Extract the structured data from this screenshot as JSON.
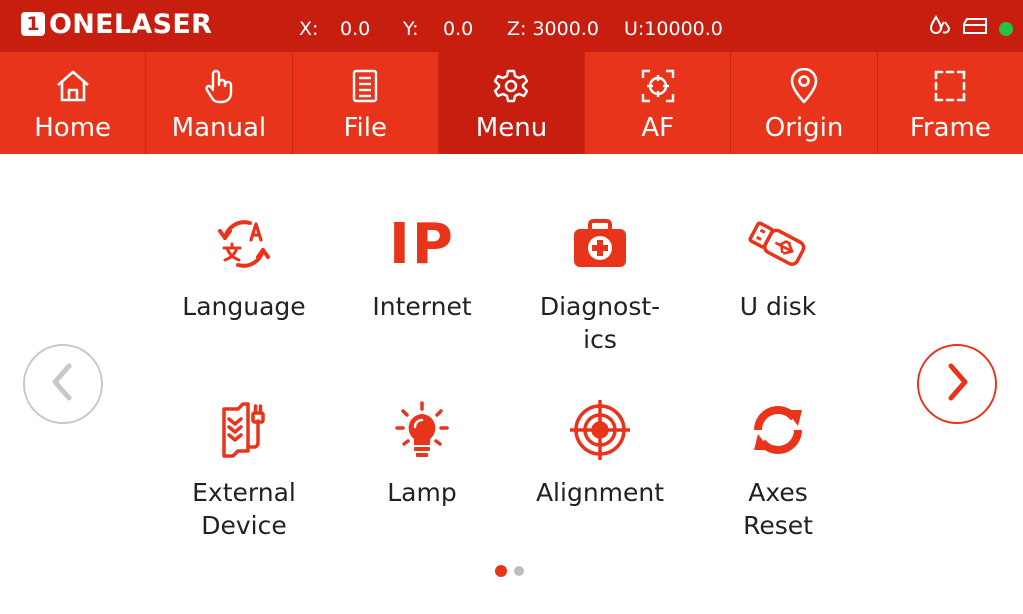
{
  "brand": {
    "badge": "1",
    "name": "ONELASER"
  },
  "coords": {
    "x_label": "X:",
    "x_value": "0.0",
    "y_label": "Y:",
    "y_value": "0.0",
    "z": "Z: 3000.0",
    "u": "U:10000.0"
  },
  "status": {
    "icons": [
      "water-drops-icon",
      "material-tray-icon",
      "connection-status-dot"
    ],
    "online_color": "#22c24a"
  },
  "nav": {
    "tabs": [
      {
        "label": "Home",
        "icon": "home-icon",
        "active": false
      },
      {
        "label": "Manual",
        "icon": "hand-pointer-icon",
        "active": false
      },
      {
        "label": "File",
        "icon": "file-list-icon",
        "active": false
      },
      {
        "label": "Menu",
        "icon": "gear-icon",
        "active": true
      },
      {
        "label": "AF",
        "icon": "autofocus-crosshair-icon",
        "active": false
      },
      {
        "label": "Origin",
        "icon": "location-pin-icon",
        "active": false
      },
      {
        "label": "Frame",
        "icon": "dashed-frame-icon",
        "active": false
      }
    ]
  },
  "menu": {
    "items": [
      {
        "label": "Language",
        "icon": "language-translate-icon"
      },
      {
        "label": "Internet",
        "icon": "ip-icon",
        "icon_text": "IP"
      },
      {
        "label": "Diagnost-\nics",
        "icon": "first-aid-kit-icon"
      },
      {
        "label": "U disk",
        "icon": "usb-drive-icon"
      },
      {
        "label": "External\nDevice",
        "icon": "external-device-icon"
      },
      {
        "label": "Lamp",
        "icon": "lamp-bulb-icon"
      },
      {
        "label": "Alignment",
        "icon": "target-crosshair-icon"
      },
      {
        "label": "Axes\nReset",
        "icon": "axes-reset-arrows-icon"
      }
    ]
  },
  "pager": {
    "current_page": 1,
    "total_pages": 2,
    "active_color": "#e8341b",
    "inactive_color": "#bdbdbd"
  },
  "colors": {
    "accent": "#e8341b",
    "accent_dark": "#c81e10",
    "text": "#222222"
  }
}
